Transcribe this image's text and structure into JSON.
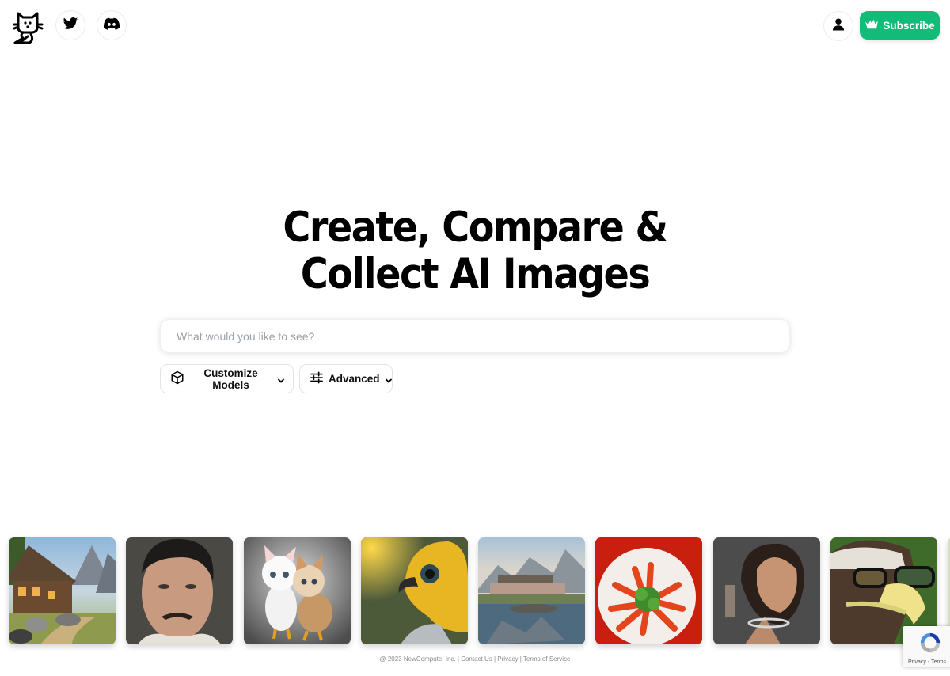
{
  "header": {
    "logo_alt": "cat-fox logo",
    "social": [
      {
        "name": "twitter",
        "icon": "twitter-icon"
      },
      {
        "name": "discord",
        "icon": "discord-icon"
      }
    ],
    "user_icon": "user-icon",
    "subscribe_label": "Subscribe",
    "subscribe_icon": "crown-icon",
    "accent_color": "#12bb78"
  },
  "hero": {
    "title_line1": "Create, Compare &",
    "title_line2": "Collect AI Images"
  },
  "search": {
    "placeholder": "What would you like to see?",
    "value": ""
  },
  "options": {
    "models_label": "Customize Models",
    "models_icon": "cube-icon",
    "advanced_label": "Advanced",
    "advanced_icon": "sliders-icon"
  },
  "gallery": {
    "items": [
      {
        "subject": "mountain cabin"
      },
      {
        "subject": "man portrait with mustache"
      },
      {
        "subject": "kittens with chicken bodies"
      },
      {
        "subject": "yellow bird"
      },
      {
        "subject": "lakeside mountain house"
      },
      {
        "subject": "carrots on a plate"
      },
      {
        "subject": "woman portrait"
      },
      {
        "subject": "eagle with glasses"
      }
    ]
  },
  "footer": {
    "copyright": "@ 2023 NewCompute, Inc.",
    "sep": " | ",
    "contact": "Contact Us",
    "privacy": "Privacy",
    "terms": "Terms of Service"
  },
  "recaptcha": {
    "links": "Privacy - Terms"
  }
}
